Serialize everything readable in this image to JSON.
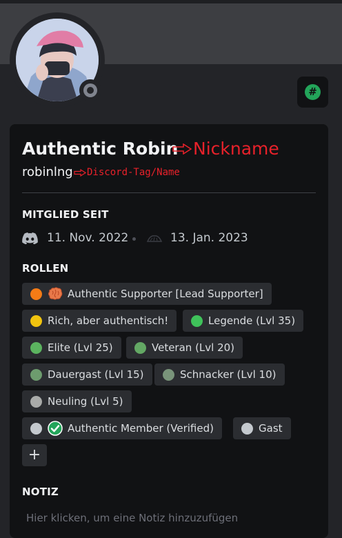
{
  "profile": {
    "display_name": "Authentic Robin",
    "username": "robinlng",
    "status": "offline",
    "server_badge_icon": "hashtag-icon"
  },
  "annotations": {
    "nickname_label": "Nickname",
    "tag_label": "Discord-Tag/Name",
    "color": "#e8212a"
  },
  "member_since": {
    "heading": "MITGLIED SEIT",
    "discord_date": "11. Nov. 2022",
    "server_date": "13. Jan. 2023"
  },
  "roles": {
    "heading": "ROLLEN",
    "items": [
      {
        "label": "Authentic Supporter [Lead Supporter]",
        "color": "#f47b16",
        "emoji": "brain"
      },
      {
        "label": "Rich, aber authentisch!",
        "color": "#f1c40f"
      },
      {
        "label": "Legende (Lvl 35)",
        "color": "#3fc25a"
      },
      {
        "label": "Elite (Lvl 25)",
        "color": "#5bb35f"
      },
      {
        "label": "Veteran (Lvl 20)",
        "color": "#63a864"
      },
      {
        "label": "Dauergast (Lvl 15)",
        "color": "#6d9c6e"
      },
      {
        "label": "Schnacker (Lvl 10)",
        "color": "#79947a"
      },
      {
        "label": "Neuling (Lvl 5)",
        "color": "#a9aba9"
      },
      {
        "label": "Authentic Member (Verified)",
        "color": "#c4c9ce",
        "emoji": "check"
      },
      {
        "label": "Gast",
        "color": "#c4c9ce"
      }
    ],
    "add_label": "+"
  },
  "note": {
    "heading": "NOTIZ",
    "placeholder": "Hier klicken, um eine Notiz hinzuzufügen"
  }
}
